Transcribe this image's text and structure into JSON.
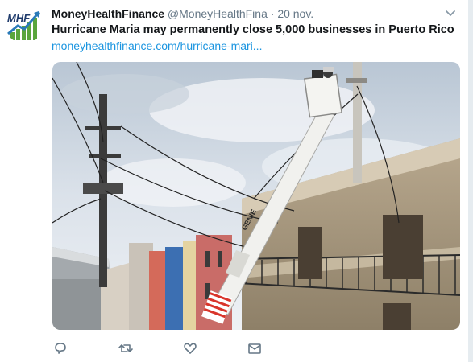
{
  "tweet": {
    "author_name": "MoneyHealthFinance",
    "author_handle": "@MoneyHealthFina",
    "separator": "·",
    "timestamp": "20 nov.",
    "headline": "Hurricane Maria may permanently close 5,000 businesses in Puerto Rico",
    "link_text": "moneyhealthfinance.com/hurricane-mari...",
    "avatar_text": "MHF"
  },
  "media": {
    "crane_brand": "GENIE",
    "description": "Utility bucket truck fixing power lines on a street in Puerto Rico"
  },
  "actions": [
    {
      "icon": "reply-icon"
    },
    {
      "icon": "retweet-icon"
    },
    {
      "icon": "like-icon"
    },
    {
      "icon": "direct-message-icon"
    }
  ],
  "colors": {
    "name": "#14171a",
    "muted": "#657786",
    "link": "#1b95e0",
    "avatar_green": "#5aa63c",
    "avatar_blue": "#2a7ab8"
  }
}
